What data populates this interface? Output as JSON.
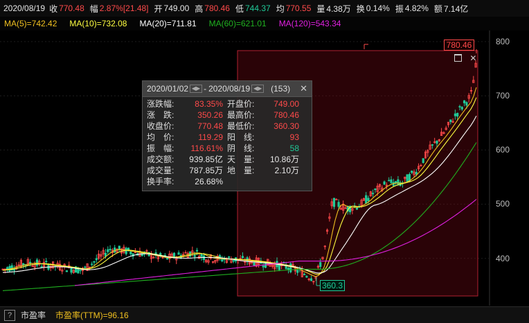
{
  "topbar": {
    "date": "2020/08/19",
    "close_label": "收",
    "close_value": "770.48",
    "change_label": "幅",
    "change_value": "2.87%[21.48]",
    "open_label": "开",
    "open_value": "749.00",
    "high_label": "高",
    "high_value": "780.46",
    "low_label": "低",
    "low_value": "744.37",
    "avg_label": "均",
    "avg_value": "770.55",
    "volume_label": "量",
    "volume_value": "4.38万",
    "turnover_label": "换",
    "turnover_value": "0.14%",
    "amplitude_label": "振",
    "amplitude_value": "4.82%",
    "amount_label": "额",
    "amount_value": "7.14亿"
  },
  "ma_bar": {
    "ma5": "MA(5)=742.42",
    "ma10": "MA(10)=732.08",
    "ma20": "MA(20)=711.81",
    "ma60": "MA(60)=621.01",
    "ma120": "MA(120)=543.34"
  },
  "colors": {
    "ma5": "#f0c020",
    "ma10": "#ffff40",
    "ma20": "#ffffff",
    "ma60": "#20b020",
    "ma120": "#e020e0",
    "up": "#ff4a4a",
    "down": "#20c997"
  },
  "axis": {
    "ticks": [
      "800",
      "700",
      "600",
      "500",
      "400"
    ]
  },
  "markers": {
    "high_tag": "780.46",
    "low_tag": "360.3"
  },
  "popup": {
    "range_start": "2020/01/02",
    "range_sep": "-",
    "range_end": "2020/08/19",
    "count": "(153)",
    "rows": [
      {
        "l1": "涨跌幅:",
        "v1": "83.35%",
        "l2": "开盘价:",
        "v2": "749.00"
      },
      {
        "l1": "涨　跌:",
        "v1": "350.26",
        "l2": "最高价:",
        "v2": "780.46"
      },
      {
        "l1": "收盘价:",
        "v1": "770.48",
        "l2": "最低价:",
        "v2": "360.30"
      },
      {
        "l1": "均　价:",
        "v1": "119.29",
        "l2": "阳　线:",
        "v2": "93"
      },
      {
        "l1": "振　幅:",
        "v1": "116.61%",
        "l2": "阴　线:",
        "v2": "58"
      },
      {
        "l1": "成交额:",
        "v1": "939.85亿",
        "l2": "天　量:",
        "v2": "10.86万"
      },
      {
        "l1": "成交量:",
        "v1": "787.85万",
        "l2": "地　量:",
        "v2": "2.10万"
      },
      {
        "l1": "换手率:",
        "v1": "26.68%",
        "l2": "",
        "v2": ""
      }
    ],
    "close_icon": "close-icon"
  },
  "bottombar": {
    "help": "?",
    "pe_label": "市盈率",
    "pe_value": "市盈率(TTM)=96.16"
  }
}
